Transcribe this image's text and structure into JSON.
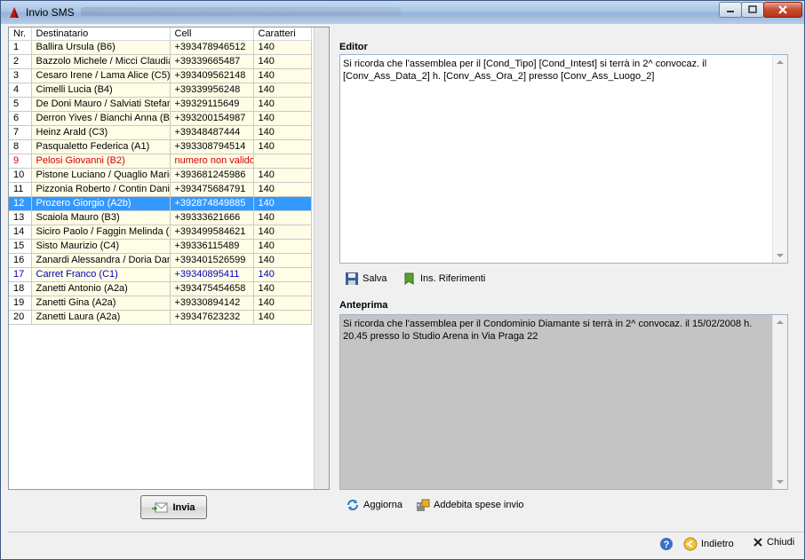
{
  "window": {
    "title": "Invio SMS"
  },
  "table": {
    "columns": [
      "Nr.",
      "Destinatario",
      "Cell",
      "Caratteri"
    ],
    "rows": [
      {
        "nr": "1",
        "dest": "Ballira Ursula (B6)",
        "cell": "+393478946512",
        "car": "140",
        "state": "normal"
      },
      {
        "nr": "2",
        "dest": "Bazzolo Michele / Micci Claudia",
        "cell": "+39339665487",
        "car": "140",
        "state": "normal"
      },
      {
        "nr": "3",
        "dest": "Cesaro Irene / Lama Alice (C5)",
        "cell": "+393409562148",
        "car": "140",
        "state": "normal"
      },
      {
        "nr": "4",
        "dest": "Cimelli Lucia (B4)",
        "cell": "+39339956248",
        "car": "140",
        "state": "normal"
      },
      {
        "nr": "5",
        "dest": "De Doni Mauro / Salviati Stefan",
        "cell": "+39329115649",
        "car": "140",
        "state": "normal"
      },
      {
        "nr": "6",
        "dest": "Derron Yives / Bianchi Anna (B",
        "cell": "+393200154987",
        "car": "140",
        "state": "normal"
      },
      {
        "nr": "7",
        "dest": "Heinz Arald (C3)",
        "cell": "+39348487444",
        "car": "140",
        "state": "normal"
      },
      {
        "nr": "8",
        "dest": "Pasqualetto Federica (A1)",
        "cell": "+393308794514",
        "car": "140",
        "state": "normal"
      },
      {
        "nr": "9",
        "dest": "Pelosi Giovanni (B2)",
        "cell": "numero non valido",
        "car": "",
        "state": "red"
      },
      {
        "nr": "10",
        "dest": "Pistone Luciano / Quaglio Maric",
        "cell": "+393681245986",
        "car": "140",
        "state": "normal"
      },
      {
        "nr": "11",
        "dest": "Pizzonia Roberto / Contin Danie",
        "cell": "+393475684791",
        "car": "140",
        "state": "normal"
      },
      {
        "nr": "12",
        "dest": "Prozero Giorgio (A2b)",
        "cell": "+392874849885",
        "car": "140",
        "state": "sel"
      },
      {
        "nr": "13",
        "dest": "Scaiola Mauro (B3)",
        "cell": "+39333621666",
        "car": "140",
        "state": "normal"
      },
      {
        "nr": "14",
        "dest": "Siciro Paolo / Faggin Melinda (I",
        "cell": "+393499584621",
        "car": "140",
        "state": "normal"
      },
      {
        "nr": "15",
        "dest": "Sisto Maurizio (C4)",
        "cell": "+39336115489",
        "car": "140",
        "state": "normal"
      },
      {
        "nr": "16",
        "dest": "Zanardi Alessandra / Doria Dan",
        "cell": "+393401526599",
        "car": "140",
        "state": "normal"
      },
      {
        "nr": "17",
        "dest": "Carret Franco (C1)",
        "cell": "+39340895411",
        "car": "140",
        "state": "blue"
      },
      {
        "nr": "18",
        "dest": "Zanetti Antonio (A2a)",
        "cell": "+393475454658",
        "car": "140",
        "state": "normal"
      },
      {
        "nr": "19",
        "dest": "Zanetti Gina (A2a)",
        "cell": "+39330894142",
        "car": "140",
        "state": "normal"
      },
      {
        "nr": "20",
        "dest": "Zanetti Laura (A2a)",
        "cell": "+39347623232",
        "car": "140",
        "state": "normal"
      }
    ]
  },
  "buttons": {
    "invia": "Invia",
    "salva": "Salva",
    "ins_riferimenti": "Ins. Riferimenti",
    "aggiorna": "Aggiorna",
    "addebita": "Addebita spese invio",
    "indietro": "Indietro",
    "chiudi": "Chiudi"
  },
  "editor": {
    "label": "Editor",
    "text": "Si ricorda che l'assemblea per il [Cond_Tipo] [Cond_Intest] si terrà in 2^ convocaz. il [Conv_Ass_Data_2] h. [Conv_Ass_Ora_2] presso [Conv_Ass_Luogo_2]"
  },
  "preview": {
    "label": "Anteprima",
    "text": "Si ricorda che l'assemblea per il Condominio Diamante si terrà in 2^ convocaz. il 15/02/2008 h. 20.45 presso lo Studio Arena in Via Praga 22"
  },
  "icons": [
    "app-icon",
    "minimize-icon",
    "maximize-icon",
    "close-icon",
    "sms-send-icon",
    "save-icon",
    "insert-reference-icon",
    "refresh-icon",
    "charge-icon",
    "help-icon",
    "back-icon",
    "close-x-icon"
  ]
}
